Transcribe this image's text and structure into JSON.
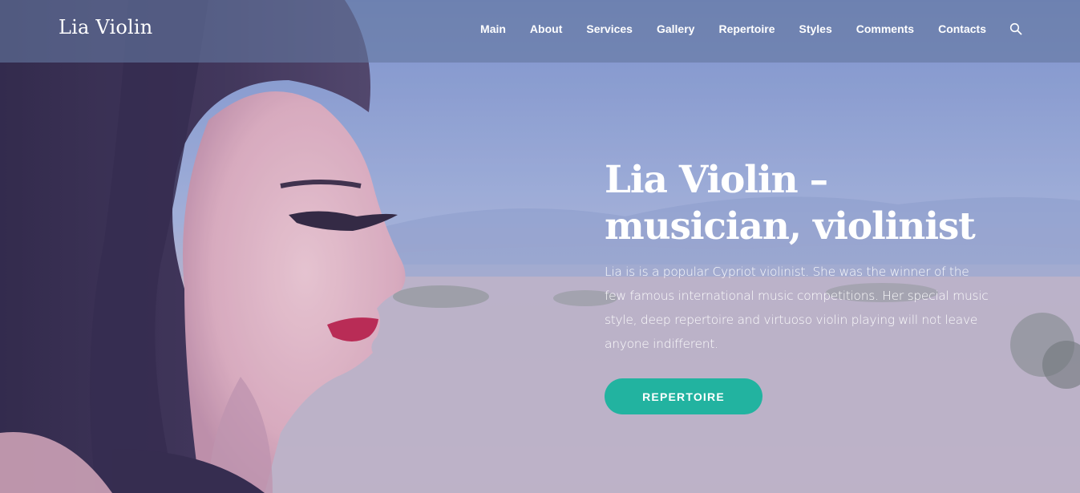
{
  "brand": {
    "name": "Lia Violin"
  },
  "nav": {
    "items": [
      {
        "label": "Main"
      },
      {
        "label": "About"
      },
      {
        "label": "Services"
      },
      {
        "label": "Gallery"
      },
      {
        "label": "Repertoire"
      },
      {
        "label": "Styles"
      },
      {
        "label": "Comments"
      },
      {
        "label": "Contacts"
      }
    ],
    "search_icon": "search-icon"
  },
  "hero": {
    "title_line1": "Lia Violin –",
    "title_line2": "musician, violinist",
    "description": "Lia is  is a popular Cypriot violinist. She was the winner of the few famous international music competitions. Her special music style, deep repertoire and virtuoso violin playing will not leave anyone indifferent.",
    "button_label": "REPERTOIRE"
  },
  "colors": {
    "accent": "#22b3a0",
    "navbar": "#64789f",
    "text": "#ffffff"
  }
}
